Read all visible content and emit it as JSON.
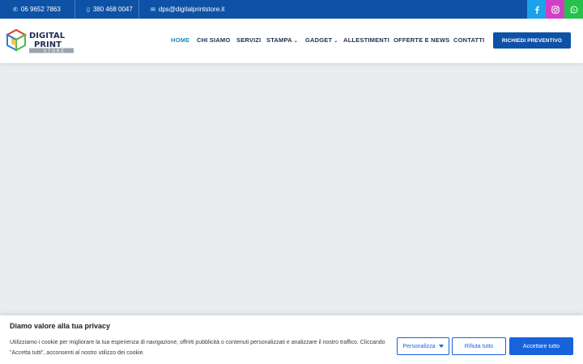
{
  "topbar": {
    "phone": "06 9652 7863",
    "mobile": "380 468 0047",
    "email": "dps@digitalprintstore.it",
    "social": [
      {
        "name": "facebook-icon",
        "color": "#1aa3e8"
      },
      {
        "name": "instagram-icon",
        "color": "#d23fc7"
      },
      {
        "name": "whatsapp-icon",
        "color": "#25c24a"
      }
    ]
  },
  "logo": {
    "line1": "DIGITAL",
    "line2": "PRINT",
    "line3": "STORE"
  },
  "nav": {
    "items": [
      "HOME",
      "CHI SIAMO",
      "SERVIZI",
      "STAMPA",
      "GADGET",
      "ALLESTIMENTI",
      "OFFERTE E NEWS",
      "CONTATTI"
    ],
    "active": "HOME"
  },
  "cta": {
    "label": "RICHIEDI PREVENTIVO"
  },
  "cookie": {
    "title": "Diamo valore alla tua privacy",
    "text": "Utilizziamo i cookie per migliorare la tua esperienza di navigazione, offrirti pubblicità o contenuti personalizzati e analizzare il nostro traffico. Cliccando \"Accetta tutti\", acconsenti al nostro utilizzo dei cookie.",
    "customize": "Personalizza",
    "reject": "Rifiuta tutto",
    "accept": "Accettare tutto"
  },
  "colors": {
    "brand": "#0d52a6",
    "accent": "#1863dc",
    "active_nav": "#1e86c7"
  }
}
